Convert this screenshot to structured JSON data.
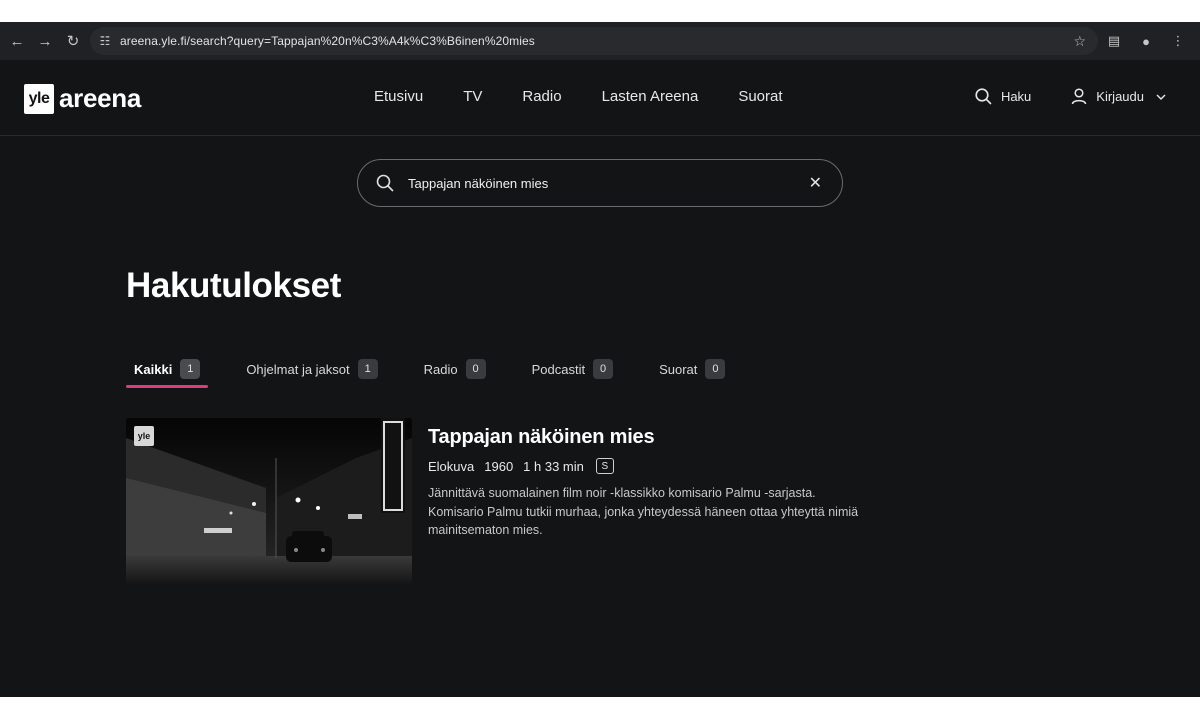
{
  "browser": {
    "url": "areena.yle.fi/search?query=Tappajan%20n%C3%A4k%C3%B6inen%20mies"
  },
  "header": {
    "logo_yle": "yle",
    "logo_areena": "areena",
    "nav": [
      "Etusivu",
      "TV",
      "Radio",
      "Lasten Areena",
      "Suorat"
    ],
    "search_label": "Haku",
    "login_label": "Kirjaudu"
  },
  "search": {
    "value": "Tappajan näköinen mies"
  },
  "page": {
    "title": "Hakutulokset"
  },
  "tabs": [
    {
      "label": "Kaikki",
      "count": "1",
      "active": true
    },
    {
      "label": "Ohjelmat ja jaksot",
      "count": "1",
      "active": false
    },
    {
      "label": "Radio",
      "count": "0",
      "active": false
    },
    {
      "label": "Podcastit",
      "count": "0",
      "active": false
    },
    {
      "label": "Suorat",
      "count": "0",
      "active": false
    }
  ],
  "result": {
    "badge": "yle",
    "title": "Tappajan näköinen mies",
    "type": "Elokuva",
    "year": "1960",
    "duration": "1 h 33 min",
    "rating": "S",
    "description": "Jännittävä suomalainen film noir -klassikko komisario Palmu -sarjasta. Komisario Palmu tutkii murhaa, jonka yhteydessä häneen ottaa yhteyttä nimiä mainitsematon mies."
  },
  "colors": {
    "background": "#131415",
    "accent": "#e0397f"
  }
}
